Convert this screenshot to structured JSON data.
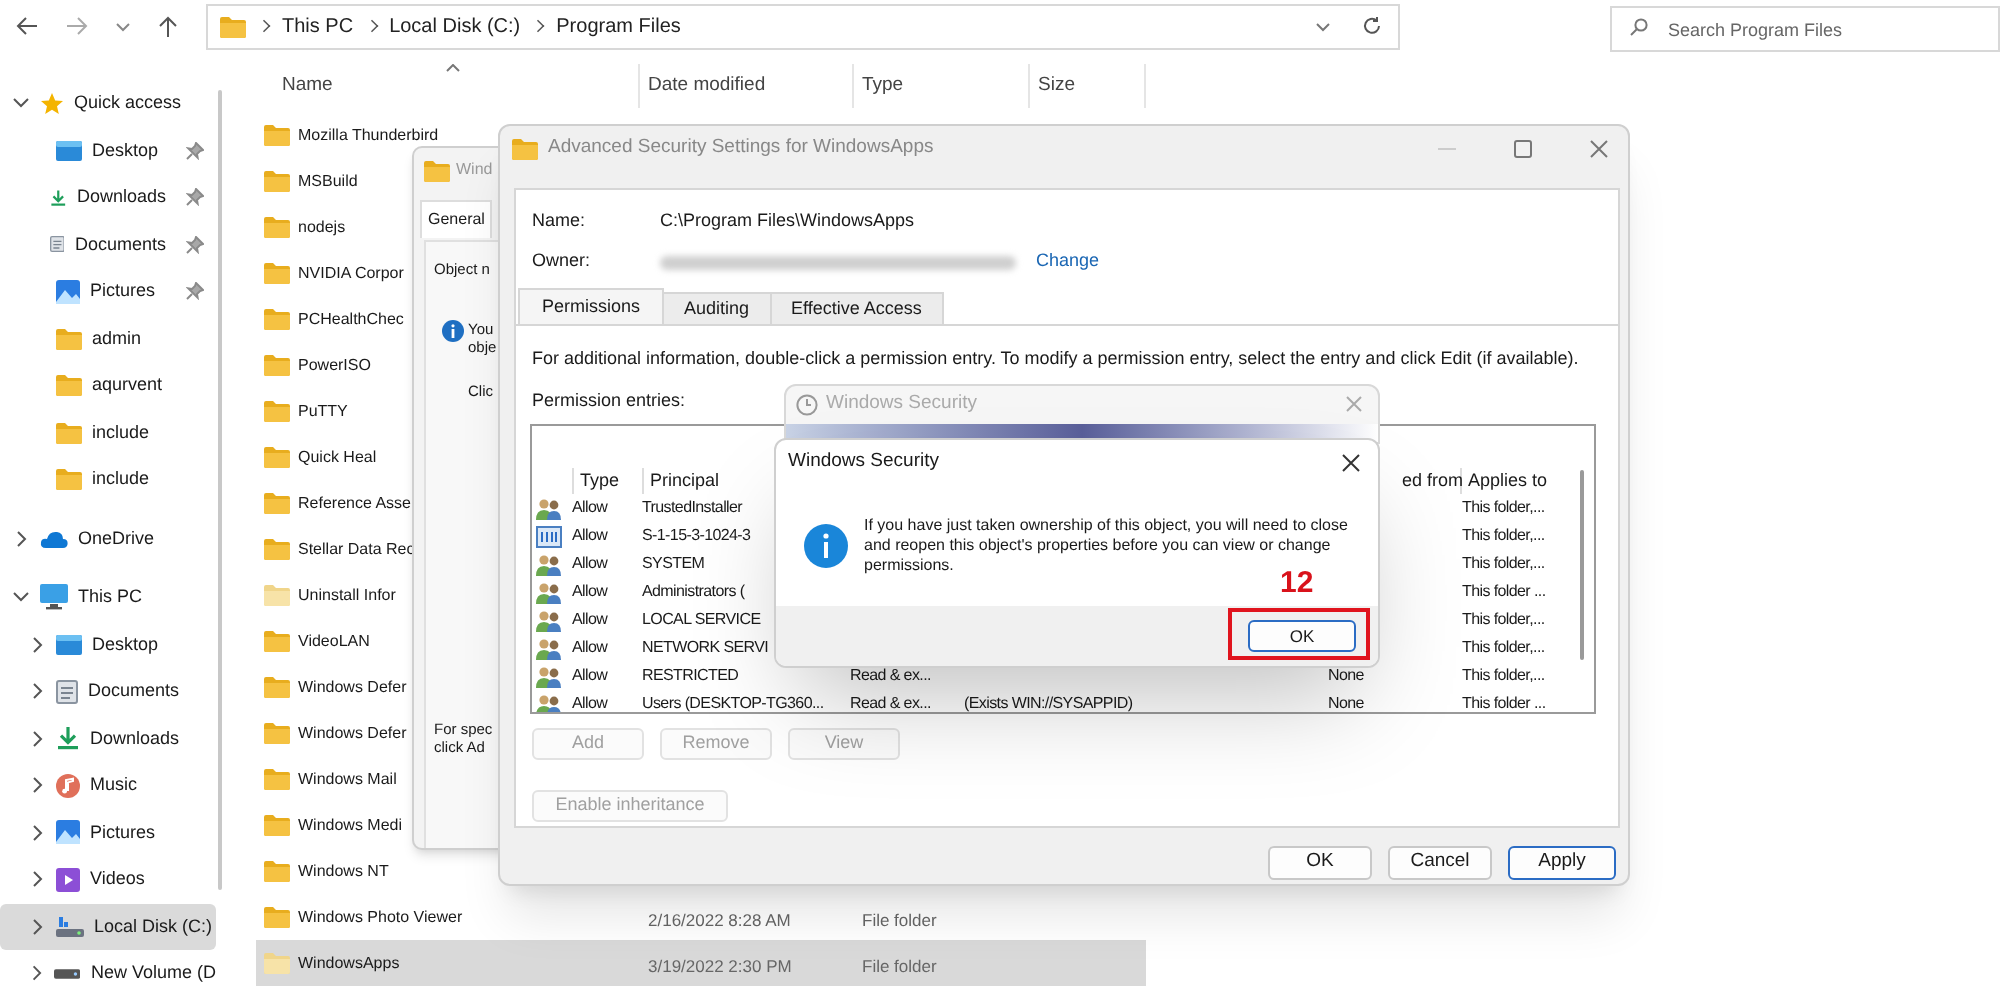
{
  "explorer": {
    "address": [
      "This PC",
      "Local Disk (C:)",
      "Program Files"
    ],
    "search": {
      "placeholder": "Search Program Files"
    },
    "sidebar": [
      {
        "label": "Quick access",
        "kind": "star",
        "expanded": true,
        "children": [
          {
            "label": "Desktop",
            "kind": "desktop",
            "pinned": true
          },
          {
            "label": "Downloads",
            "kind": "download",
            "pinned": true
          },
          {
            "label": "Documents",
            "kind": "document",
            "pinned": true
          },
          {
            "label": "Pictures",
            "kind": "picture",
            "pinned": true
          },
          {
            "label": "admin",
            "kind": "folder",
            "pinned": false
          },
          {
            "label": "aqurvent",
            "kind": "folder",
            "pinned": false
          },
          {
            "label": "include",
            "kind": "folder",
            "pinned": false
          },
          {
            "label": "include",
            "kind": "folder",
            "pinned": false
          }
        ]
      },
      {
        "label": "OneDrive",
        "kind": "cloud",
        "expanded": false
      },
      {
        "label": "This PC",
        "kind": "pc",
        "expanded": true,
        "children": [
          {
            "label": "Desktop",
            "kind": "desktop",
            "expanded": false,
            "selected": false
          },
          {
            "label": "Documents",
            "kind": "document",
            "expanded": false,
            "selected": false
          },
          {
            "label": "Downloads",
            "kind": "download",
            "expanded": false,
            "selected": false
          },
          {
            "label": "Music",
            "kind": "music",
            "expanded": false,
            "selected": false
          },
          {
            "label": "Pictures",
            "kind": "picture",
            "expanded": false,
            "selected": false
          },
          {
            "label": "Videos",
            "kind": "video",
            "expanded": false,
            "selected": false
          },
          {
            "label": "Local Disk (C:)",
            "kind": "drive",
            "expanded": false,
            "selected": true
          },
          {
            "label": "New Volume (D",
            "kind": "volume",
            "expanded": false,
            "selected": false
          }
        ]
      }
    ],
    "columns": [
      "Name",
      "Date modified",
      "Type",
      "Size"
    ],
    "files": [
      {
        "name": "Mozilla Thunderbird",
        "hidden": false,
        "selected": false
      },
      {
        "name": "MSBuild",
        "hidden": false,
        "selected": false
      },
      {
        "name": "nodejs",
        "hidden": false,
        "selected": false
      },
      {
        "name": "NVIDIA Corpor",
        "hidden": false,
        "selected": false
      },
      {
        "name": "PCHealthChec",
        "hidden": false,
        "selected": false
      },
      {
        "name": "PowerISO",
        "hidden": false,
        "selected": false
      },
      {
        "name": "PuTTY",
        "hidden": false,
        "selected": false
      },
      {
        "name": "Quick Heal",
        "hidden": false,
        "selected": false
      },
      {
        "name": "Reference Asse",
        "hidden": false,
        "selected": false
      },
      {
        "name": "Stellar Data Rec",
        "hidden": false,
        "selected": false
      },
      {
        "name": "Uninstall Infor",
        "hidden": true,
        "selected": false
      },
      {
        "name": "VideoLAN",
        "hidden": false,
        "selected": false
      },
      {
        "name": "Windows Defer",
        "hidden": false,
        "selected": false
      },
      {
        "name": "Windows Defer",
        "hidden": false,
        "selected": false
      },
      {
        "name": "Windows Mail",
        "hidden": false,
        "selected": false
      },
      {
        "name": "Windows Medi",
        "hidden": false,
        "selected": false
      },
      {
        "name": "Windows NT",
        "hidden": false,
        "selected": false
      },
      {
        "name": "Windows Photo Viewer",
        "date": "2/16/2022 8:28 AM",
        "type": "File folder",
        "hidden": false,
        "selected": false
      },
      {
        "name": "WindowsApps",
        "date": "3/19/2022 2:30 PM",
        "type": "File folder",
        "hidden": true,
        "selected": true
      }
    ]
  },
  "properties_window": {
    "title": "Wind",
    "tab": "General",
    "object_label": "Object n",
    "info_lines": [
      "You",
      "obje"
    ],
    "click_text": "Clic",
    "footer_lines": [
      "For spec",
      "click Ad"
    ]
  },
  "advanced_window": {
    "title": "Advanced Security Settings for WindowsApps",
    "name_label": "Name:",
    "name_value": "C:\\Program Files\\WindowsApps",
    "owner_label": "Owner:",
    "change_link": "Change",
    "tabs": [
      {
        "label": "Permissions",
        "selected": true
      },
      {
        "label": "Auditing",
        "selected": false
      },
      {
        "label": "Effective Access",
        "selected": false
      }
    ],
    "info": "For additional information, double-click a permission entry. To modify a permission entry, select the entry and click Edit (if available).",
    "entries_label": "Permission entries:",
    "entry_columns": [
      "Type",
      "Principal",
      "ed from",
      "Applies to"
    ],
    "entries": [
      {
        "kind": "group",
        "type": "Allow",
        "principal": "TrustedInstaller",
        "applies": "This folder,..."
      },
      {
        "kind": "app",
        "type": "Allow",
        "principal": "S-1-15-3-1024-3",
        "applies": "This folder,..."
      },
      {
        "kind": "group",
        "type": "Allow",
        "principal": "SYSTEM",
        "applies": "This folder,..."
      },
      {
        "kind": "group",
        "type": "Allow",
        "principal": "Administrators (",
        "applies": "This folder ..."
      },
      {
        "kind": "group",
        "type": "Allow",
        "principal": "LOCAL SERVICE",
        "applies": "This folder,..."
      },
      {
        "kind": "group",
        "type": "Allow",
        "principal": "NETWORK SERVI",
        "applies": "This folder,..."
      },
      {
        "kind": "group",
        "type": "Allow",
        "principal": "RESTRICTED",
        "access": "Read & ex...",
        "inherited": "None",
        "applies": "This folder,..."
      },
      {
        "kind": "group",
        "type": "Allow",
        "principal": "Users (DESKTOP-TG360...",
        "access": "Read & ex...",
        "condition": "(Exists WIN://SYSAPPID)",
        "inherited": "None",
        "applies": "This folder ..."
      }
    ],
    "entry_buttons": [
      {
        "label": "Add",
        "disabled": true
      },
      {
        "label": "Remove",
        "disabled": true
      },
      {
        "label": "View",
        "disabled": true
      }
    ],
    "inheritance_button": {
      "label": "Enable inheritance",
      "disabled": true
    },
    "footer_buttons": [
      {
        "label": "OK",
        "focused": false
      },
      {
        "label": "Cancel",
        "focused": false
      },
      {
        "label": "Apply",
        "focused": true
      }
    ]
  },
  "back_dialog": {
    "title": "Windows Security"
  },
  "dialog": {
    "title": "Windows Security",
    "message": "If you have just taken ownership of this object, you will need to close and reopen this object's properties before you can view or change permissions.",
    "ok": "OK"
  },
  "annotation": {
    "label": "12"
  }
}
